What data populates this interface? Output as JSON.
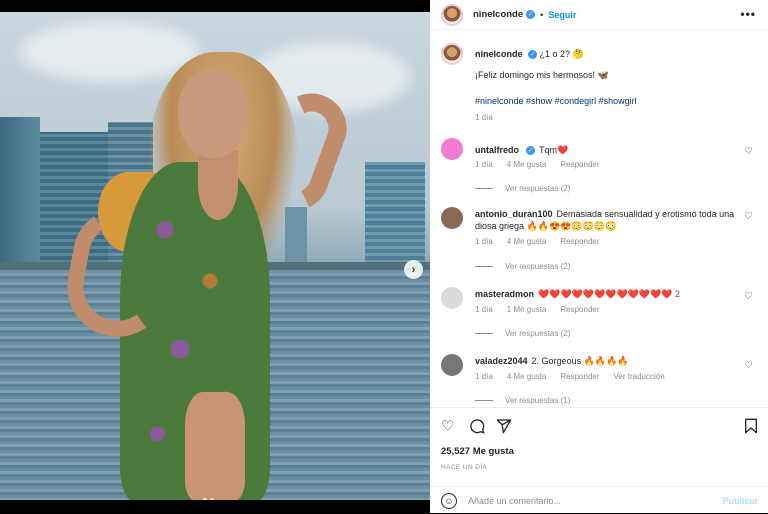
{
  "post": {
    "username": "ninelconde",
    "verified": true,
    "follow_label": "Seguir",
    "bullet": "•",
    "more_label": "•••",
    "photo": {
      "next_label": "›",
      "carousel_dots": 2,
      "active_dot": 0
    }
  },
  "caption": {
    "username": "ninelconde",
    "text": "¿1 o 2? 🤔",
    "greeting": "¡Feliz domingo mis hermosos! 🦋",
    "hashtags": "#ninelconde #show #condegirl #showgirl",
    "time": "1 día"
  },
  "comments": [
    {
      "user": "untalfredo",
      "verified": true,
      "text": "Tqm❤️",
      "time": "1 día",
      "likes": "4 Me gusta",
      "reply": "Responder",
      "translate": "",
      "view_replies": "Ver respuestas (2)",
      "avatar_color": "#f37ad0"
    },
    {
      "user": "antonio_duran100",
      "verified": false,
      "text": "Demasiada sensualidad y erotismo toda una diosa griega 🔥🔥😍😍😳😳😳😳",
      "time": "1 día",
      "likes": "4 Me gusta",
      "reply": "Responder",
      "translate": "",
      "view_replies": "Ver respuestas (2)",
      "avatar_color": "#8a6a55"
    },
    {
      "user": "masteradmon",
      "verified": false,
      "text": "❤️❤️❤️❤️❤️❤️❤️❤️❤️❤️❤️❤️ 2",
      "time": "1 día",
      "likes": "1 Me gusta",
      "reply": "Responder",
      "translate": "",
      "view_replies": "Ver respuestas (2)",
      "avatar_color": "#dbdbdb"
    },
    {
      "user": "valadez2044",
      "verified": false,
      "text": "2. Gorgeous 🔥🔥🔥🔥",
      "time": "1 día",
      "likes": "4 Me gusta",
      "reply": "Responder",
      "translate": "Ver traducción",
      "view_replies": "Ver respuestas (1)",
      "avatar_color": "#777777"
    }
  ],
  "actions": {
    "likes": "25,527 Me gusta",
    "posted": "HACE UN DÍA",
    "comment_placeholder": "Añade un comentario...",
    "publish_label": "Publicar"
  },
  "icons": {
    "like": "heart-icon",
    "comment": "comment-icon",
    "share": "share-icon",
    "save": "bookmark-icon",
    "emoji": "emoji-icon"
  },
  "colors": {
    "accent": "#0095f6",
    "hashtag": "#00376b",
    "muted": "#8e8e8e",
    "publish_disabled": "#b2dffc"
  }
}
